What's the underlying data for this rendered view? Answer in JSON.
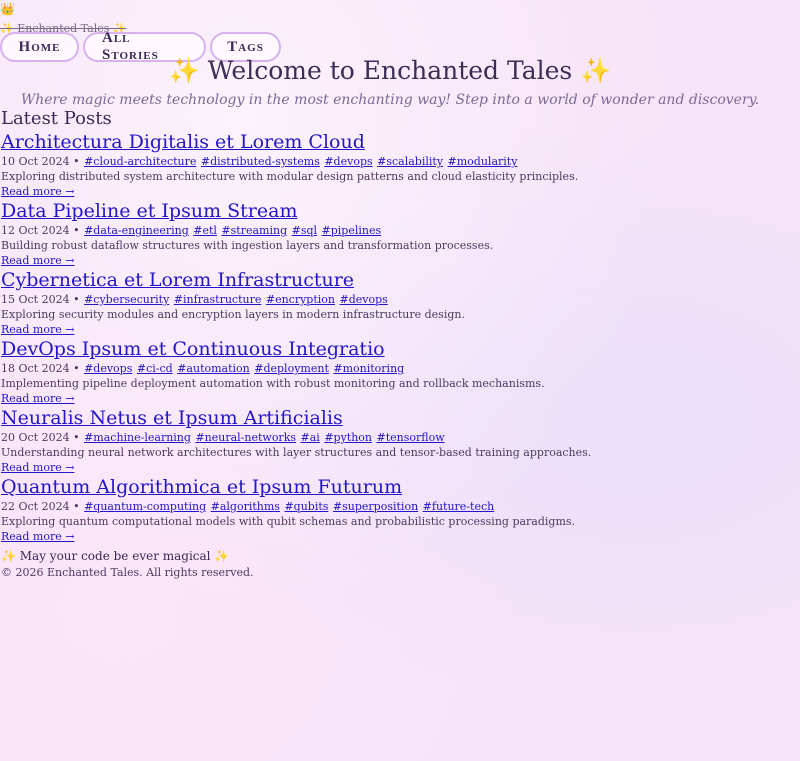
{
  "header": {
    "crown": "👑",
    "site_link": "✨ Enchanted Tales ✨",
    "nav": [
      "Home",
      "All Stories",
      "Tags"
    ]
  },
  "hero": {
    "title": "✨ Welcome to Enchanted Tales ✨",
    "subtitle": "Where magic meets technology in the most enchanting way! Step into a world of wonder and discovery."
  },
  "posts_section": {
    "title": "Latest Posts"
  },
  "posts": [
    {
      "title": "Architectura Digitalis et Lorem Cloud",
      "date": "10 Oct 2024",
      "tags": [
        "#cloud-architecture",
        "#distributed-systems",
        "#devops",
        "#scalability",
        "#modularity"
      ],
      "desc": "Exploring distributed system architecture with modular design patterns and cloud elasticity principles.",
      "read_more": "Read more →"
    },
    {
      "title": "Data Pipeline et Ipsum Stream",
      "date": "12 Oct 2024",
      "tags": [
        "#data-engineering",
        "#etl",
        "#streaming",
        "#sql",
        "#pipelines"
      ],
      "desc": "Building robust dataflow structures with ingestion layers and transformation processes.",
      "read_more": "Read more →"
    },
    {
      "title": "Cybernetica et Lorem Infrastructure",
      "date": "15 Oct 2024",
      "tags": [
        "#cybersecurity",
        "#infrastructure",
        "#encryption",
        "#devops"
      ],
      "desc": "Exploring security modules and encryption layers in modern infrastructure design.",
      "read_more": "Read more →"
    },
    {
      "title": "DevOps Ipsum et Continuous Integratio",
      "date": "18 Oct 2024",
      "tags": [
        "#devops",
        "#ci-cd",
        "#automation",
        "#deployment",
        "#monitoring"
      ],
      "desc": "Implementing pipeline deployment automation with robust monitoring and rollback mechanisms.",
      "read_more": "Read more →"
    },
    {
      "title": "Neuralis Netus et Ipsum Artificialis",
      "date": "20 Oct 2024",
      "tags": [
        "#machine-learning",
        "#neural-networks",
        "#ai",
        "#python",
        "#tensorflow"
      ],
      "desc": "Understanding neural network architectures with layer structures and tensor-based training approaches.",
      "read_more": "Read more →"
    },
    {
      "title": "Quantum Algorithmica et Ipsum Futurum",
      "date": "22 Oct 2024",
      "tags": [
        "#quantum-computing",
        "#algorithms",
        "#qubits",
        "#superposition",
        "#future-tech"
      ],
      "desc": "Exploring quantum computational models with qubit schemas and probabilistic processing paradigms.",
      "read_more": "Read more →"
    }
  ],
  "footer": {
    "tagline": "✨ May your code be ever magical ✨",
    "copyright": "© 2026 Enchanted Tales. All rights reserved."
  }
}
